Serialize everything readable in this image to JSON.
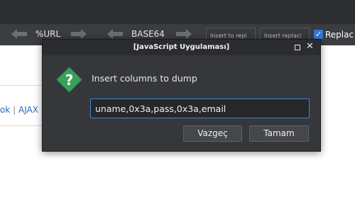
{
  "toolbar": {
    "url_label": "%URL",
    "base64_label": "BASE64",
    "insert_to_repl_label": "Insert to repl",
    "insert_replace_label": "Insert replaci",
    "replace_label": "Replac"
  },
  "page": {
    "links_left": "ok",
    "links_sep": "|",
    "links_ajax": "AJAX"
  },
  "dialog": {
    "title": "[JavaScript Uygulaması]",
    "message": "Insert columns to dump",
    "input_value": "uname,0x3a,pass,0x3a,email",
    "cancel_label": "Vazgeç",
    "ok_label": "Tamam"
  },
  "icons": {
    "prompt": "question-icon",
    "maximize": "maximize-icon",
    "close": "close-icon"
  },
  "colors": {
    "accent": "#3c85d6",
    "icon_green": "#3aa15a",
    "dialog_bg": "#35373b"
  }
}
